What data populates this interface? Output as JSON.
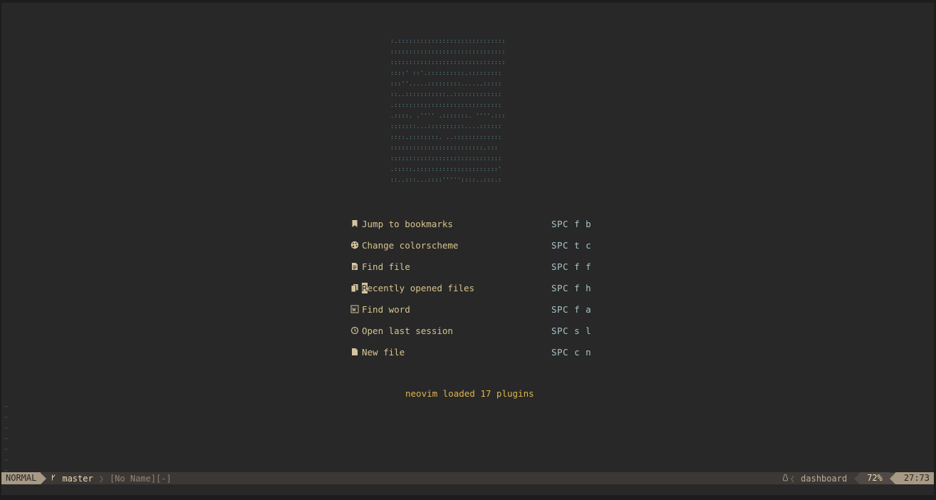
{
  "logo_art": ":.:::::::::::::::::::::::::::::\n:::::::::::::::::::::::::::::::\n:::::::::::::::::::::::::::::::\n::::' ::'.::::::::::.:::::::::\n:::''.....:::::::::......:::::\n::..:::::::::::..:::::::::::::\n.:::::::::::::::::::::::::::::\n.::::. .'''' .:::::::. ''''.:::\n:::::::...::::::::::....::::::\n::::.::::::::. ..:::::::::::::\n:::::::::::::::::::::::::.:::\n::::::::::::::::::::::::::::::\n.:::::.::::::::::::::::::::::'\n::..:::...::::'''''::::..:::.:",
  "menu": [
    {
      "icon": "bookmark-icon",
      "label": "Jump to bookmarks",
      "key": "SPC f b"
    },
    {
      "icon": "palette-icon",
      "label": "Change colorscheme",
      "key": "SPC t c"
    },
    {
      "icon": "file-text-icon",
      "label": "Find file",
      "key": "SPC f f"
    },
    {
      "icon": "files-icon",
      "label_first": "R",
      "label_rest": "ecently opened files",
      "key": "SPC f h"
    },
    {
      "icon": "word-icon",
      "label": "Find word",
      "key": "SPC f a"
    },
    {
      "icon": "history-icon",
      "label": "Open last session",
      "key": "SPC s l"
    },
    {
      "icon": "new-file-icon",
      "label": "New file",
      "key": "SPC c n"
    }
  ],
  "footer": "neovim loaded 17 plugins",
  "tildes": "~\n~\n~\n~\n~\n~\n~",
  "statusline": {
    "mode": "NORMAL",
    "branch": "master",
    "branch_icon": "git-branch-icon",
    "file": "[No Name][-]",
    "filetype": "dashboard",
    "filetype_icon": "linux-icon",
    "percent": "72%",
    "position": "27:73"
  },
  "colors": {
    "background": "#282828",
    "menu_text": "#d8c48d",
    "keys": "#a9c3c9",
    "footer": "#e0b34e",
    "logo": "#5f8fa6"
  }
}
